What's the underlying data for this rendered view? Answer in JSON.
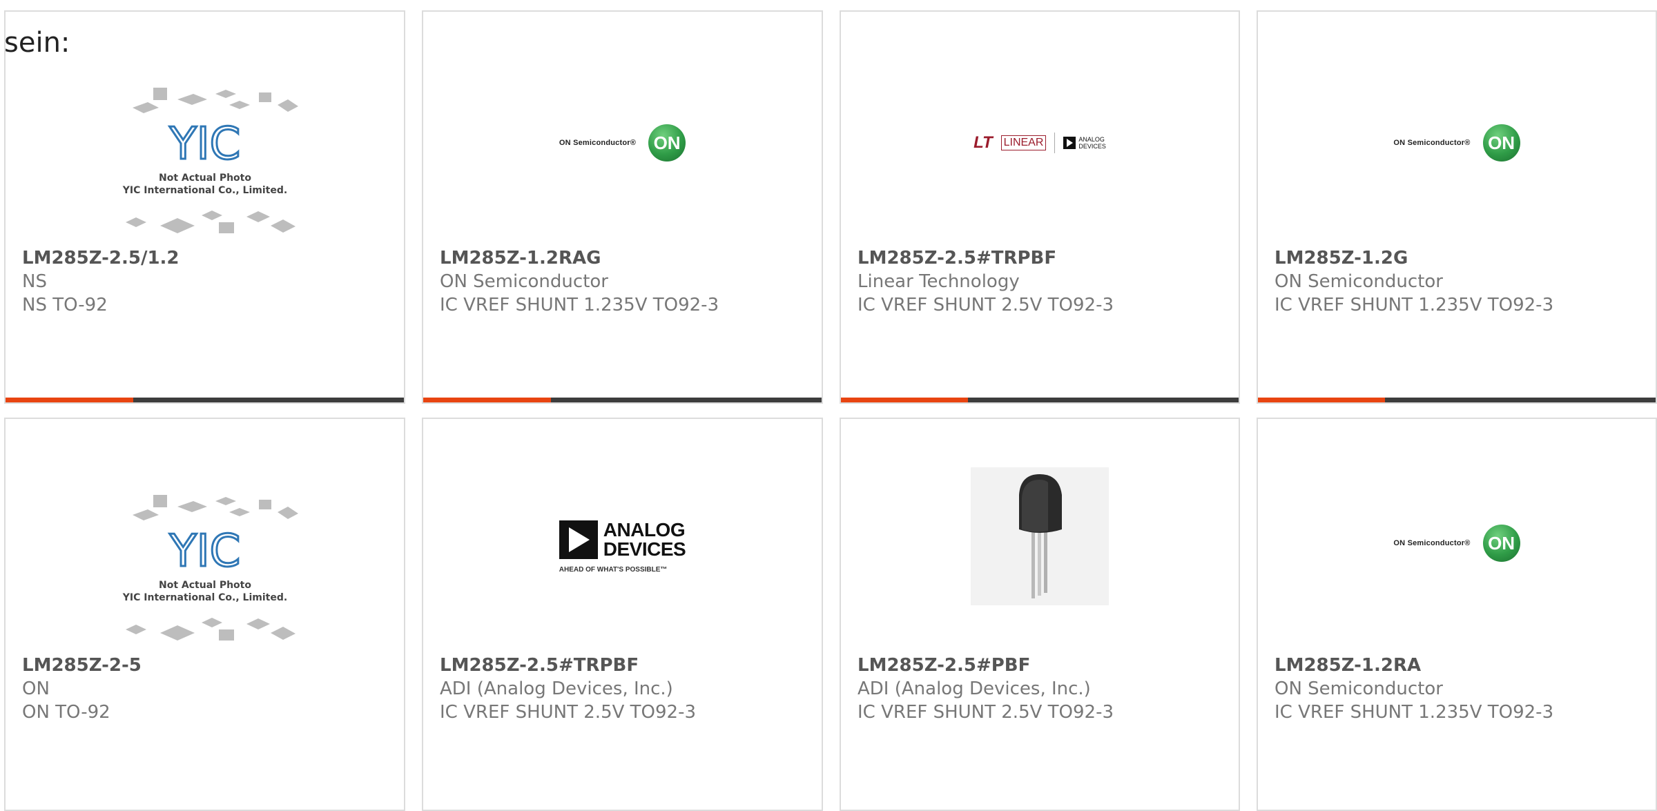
{
  "intro": "sein:",
  "placeholder_logo": {
    "brand": "YIC",
    "line1": "Not Actual Photo",
    "line2": "YIC International Co., Limited."
  },
  "on_logo": {
    "wordmark": "ON Semiconductor®",
    "badge": "ON"
  },
  "lt_logo": {
    "mark": "LT",
    "word": "LINEAR",
    "adi_line1": "ANALOG",
    "adi_line2": "DEVICES"
  },
  "adi_logo": {
    "line1": "ANALOG",
    "line2": "DEVICES",
    "tagline": "AHEAD OF WHAT'S POSSIBLE™"
  },
  "colors": {
    "accent": "#e84411",
    "bar": "#3d3d3d",
    "border": "#dcdcdc",
    "title": "#555555",
    "text": "#777777"
  },
  "products": [
    {
      "part": "LM285Z-2.5/1.2",
      "maker": "NS",
      "desc": "NS TO-92",
      "image": "yic-placeholder"
    },
    {
      "part": "LM285Z-1.2RAG",
      "maker": "ON Semiconductor",
      "desc": "IC VREF SHUNT 1.235V TO92-3",
      "image": "on-semiconductor-logo"
    },
    {
      "part": "LM285Z-2.5#TRPBF",
      "maker": "Linear Technology",
      "desc": "IC VREF SHUNT 2.5V TO92-3",
      "image": "linear-technology-logo"
    },
    {
      "part": "LM285Z-1.2G",
      "maker": "ON Semiconductor",
      "desc": "IC VREF SHUNT 1.235V TO92-3",
      "image": "on-semiconductor-logo"
    },
    {
      "part": "LM285Z-2-5",
      "maker": "ON",
      "desc": "ON TO-92",
      "image": "yic-placeholder"
    },
    {
      "part": "LM285Z-2.5#TRPBF",
      "maker": "ADI (Analog Devices, Inc.)",
      "desc": "IC VREF SHUNT 2.5V TO92-3",
      "image": "analog-devices-logo"
    },
    {
      "part": "LM285Z-2.5#PBF",
      "maker": "ADI (Analog Devices, Inc.)",
      "desc": "IC VREF SHUNT 2.5V TO92-3",
      "image": "to92-package-photo"
    },
    {
      "part": "LM285Z-1.2RA",
      "maker": "ON Semiconductor",
      "desc": "IC VREF SHUNT 1.235V TO92-3",
      "image": "on-semiconductor-logo"
    }
  ]
}
